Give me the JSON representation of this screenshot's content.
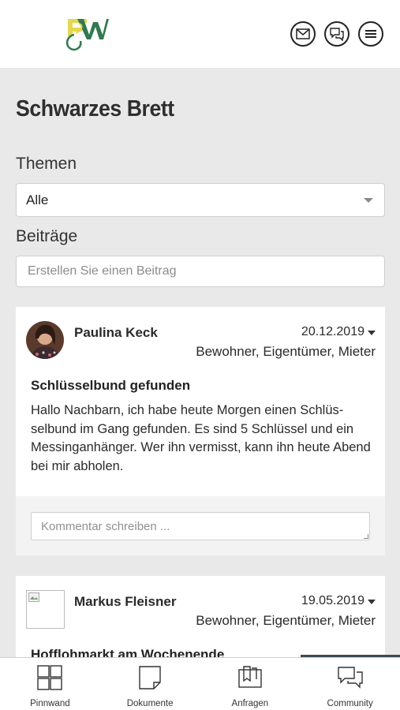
{
  "header": {
    "logo_text": "EW",
    "icons": [
      "mail-icon",
      "chat-icon",
      "menu-icon"
    ]
  },
  "page": {
    "title": "Schwarzes Brett",
    "themes_label": "Themen",
    "themes_selected": "Alle",
    "posts_label": "Beiträge",
    "create_post_placeholder": "Erstellen Sie einen Beitrag"
  },
  "posts": [
    {
      "author": "Paulina Keck",
      "date": "20.12.2019",
      "roles": "Bewohner, Eigentümer, Mieter",
      "title": "Schlüsselbund gefunden",
      "body": "Hallo Nachbarn, ich habe heute Morgen einen Schlüs-selbund im Gang gefunden. Es sind 5 Schlüssel und ein Messinganhänger. Wer ihn vermisst, kann ihn heute Abend bei mir abholen.",
      "comment_placeholder": "Kommentar schreiben ..."
    },
    {
      "author": "Markus Fleisner",
      "date": "19.05.2019",
      "roles": "Bewohner, Eigentümer, Mieter",
      "title": "Hofflohmarkt am Wochenende"
    }
  ],
  "bottom_nav": [
    {
      "label": "Pinnwand",
      "icon": "grid-icon"
    },
    {
      "label": "Dokumente",
      "icon": "document-icon"
    },
    {
      "label": "Anfragen",
      "icon": "inbox-icon"
    },
    {
      "label": "Community",
      "icon": "community-chat-icon",
      "active": true
    }
  ],
  "colors": {
    "background": "#e9e9e9",
    "active_tab_bar": "#3b4a57",
    "logo_yellow": "#e6d84a",
    "logo_green": "#2f7a4f"
  }
}
